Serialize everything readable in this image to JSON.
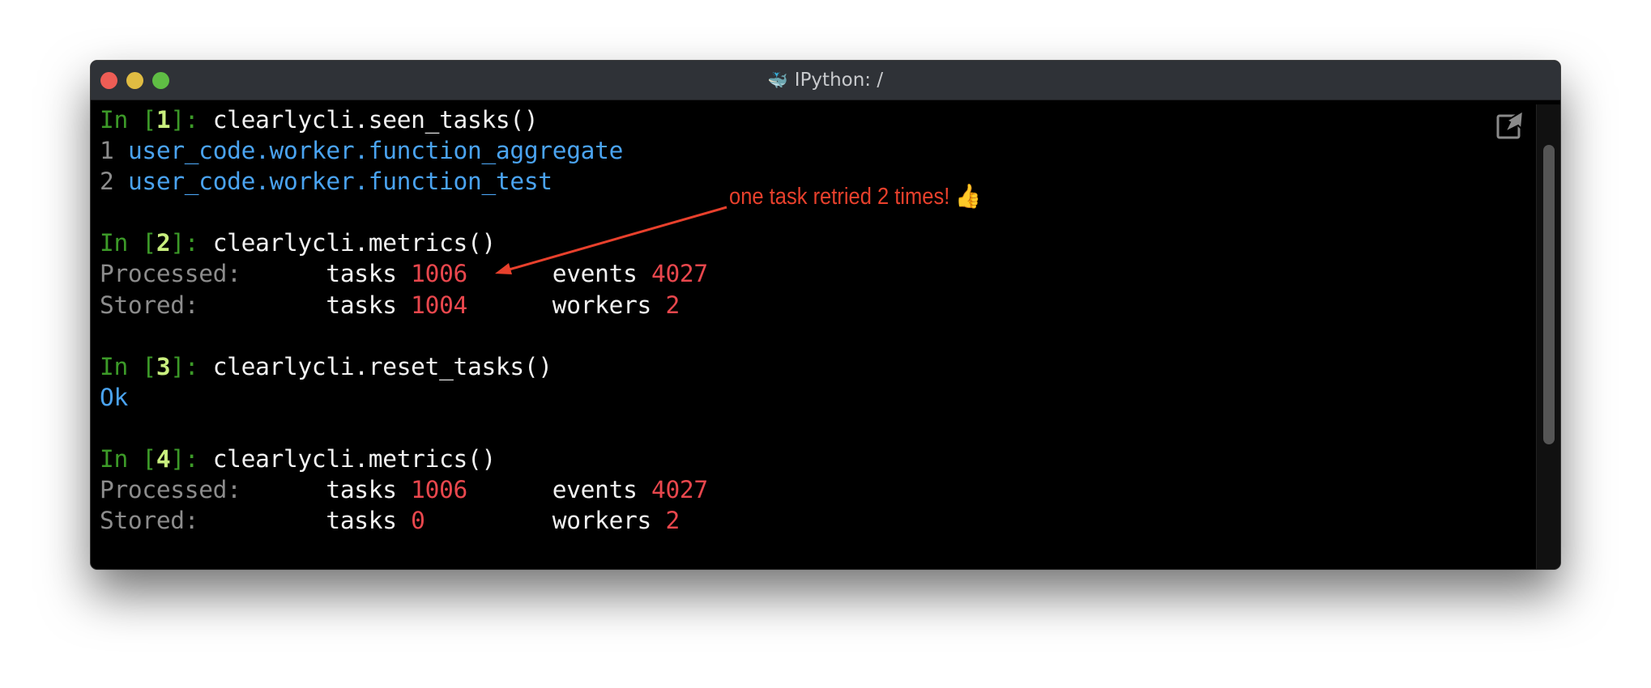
{
  "window": {
    "title": "IPython: /",
    "title_icon": "docker-whale-icon"
  },
  "session": [
    {
      "prompt": "In [",
      "num": "1",
      "close": "]: ",
      "code": "clearlycli.seen_tasks()",
      "output": [
        {
          "idx": "1",
          "text": "user_code.worker.function_aggregate"
        },
        {
          "idx": "2",
          "text": "user_code.worker.function_test"
        }
      ]
    },
    {
      "prompt": "In [",
      "num": "2",
      "close": "]: ",
      "code": "clearlycli.metrics()",
      "metrics": {
        "processed_label": "Processed:",
        "stored_label": "Stored:",
        "tasks_label": "tasks",
        "events_label": "events",
        "workers_label": "workers",
        "processed_tasks": "1006",
        "events": "4027",
        "stored_tasks": "1004",
        "workers": "2"
      }
    },
    {
      "prompt": "In [",
      "num": "3",
      "close": "]: ",
      "code": "clearlycli.reset_tasks()",
      "output_text": "Ok"
    },
    {
      "prompt": "In [",
      "num": "4",
      "close": "]: ",
      "code": "clearlycli.metrics()",
      "metrics": {
        "processed_label": "Processed:",
        "stored_label": "Stored:",
        "tasks_label": "tasks",
        "events_label": "events",
        "workers_label": "workers",
        "processed_tasks": "1006",
        "events": "4027",
        "stored_tasks": "0",
        "workers": "2"
      }
    }
  ],
  "annotation": {
    "text": "one task retried 2 times! 👍",
    "color": "#e8402c"
  },
  "colors": {
    "prompt": "#3c9a28",
    "prompt_num": "#c9ef7e",
    "output_blue": "#4aa3f0",
    "label_gray": "#8c8c8c",
    "value_red": "#e9474d"
  }
}
